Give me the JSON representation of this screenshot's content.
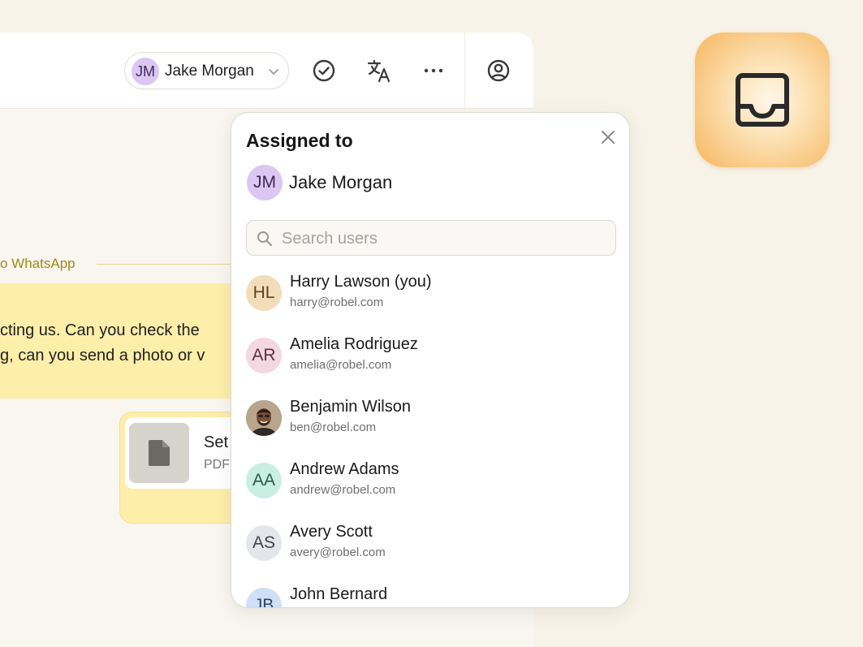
{
  "topbar": {
    "assignee": {
      "initials": "JM",
      "name": "Jake Morgan"
    },
    "icons": [
      "check-circle-icon",
      "translate-icon",
      "more-icon",
      "user-circle-icon"
    ]
  },
  "app_tile": {
    "icon": "inbox-tray-icon"
  },
  "conversation": {
    "channel_label": "o WhatsApp",
    "message_lines": [
      "cting us.  Can you check the",
      "g, can you send a photo or v"
    ],
    "attachment": {
      "name": "Set",
      "type": "PDF"
    }
  },
  "assign_popup": {
    "title": "Assigned to",
    "current": {
      "initials": "JM",
      "name": "Jake Morgan"
    },
    "search_placeholder": "Search users",
    "users": [
      {
        "initials": "HL",
        "name": "Harry Lawson (you)",
        "email": "harry@robel.com",
        "color": "#f2ddb8",
        "text_color": "#5a4320"
      },
      {
        "initials": "AR",
        "name": "Amelia Rodriguez",
        "email": "amelia@robel.com",
        "color": "#f3d8e2",
        "text_color": "#5c3342"
      },
      {
        "initials": "",
        "name": "Benjamin Wilson",
        "email": "ben@robel.com",
        "color": "#8a6a52",
        "text_color": "#ffffff"
      },
      {
        "initials": "AA",
        "name": "Andrew Adams",
        "email": "andrew@robel.com",
        "color": "#c9efe3",
        "text_color": "#2d5a4d"
      },
      {
        "initials": "AS",
        "name": "Avery Scott",
        "email": "avery@robel.com",
        "color": "#e4e6ea",
        "text_color": "#40444c"
      },
      {
        "initials": "JB",
        "name": "John Bernard",
        "email": "",
        "color": "#cfe0f6",
        "text_color": "#2c4466"
      }
    ]
  }
}
